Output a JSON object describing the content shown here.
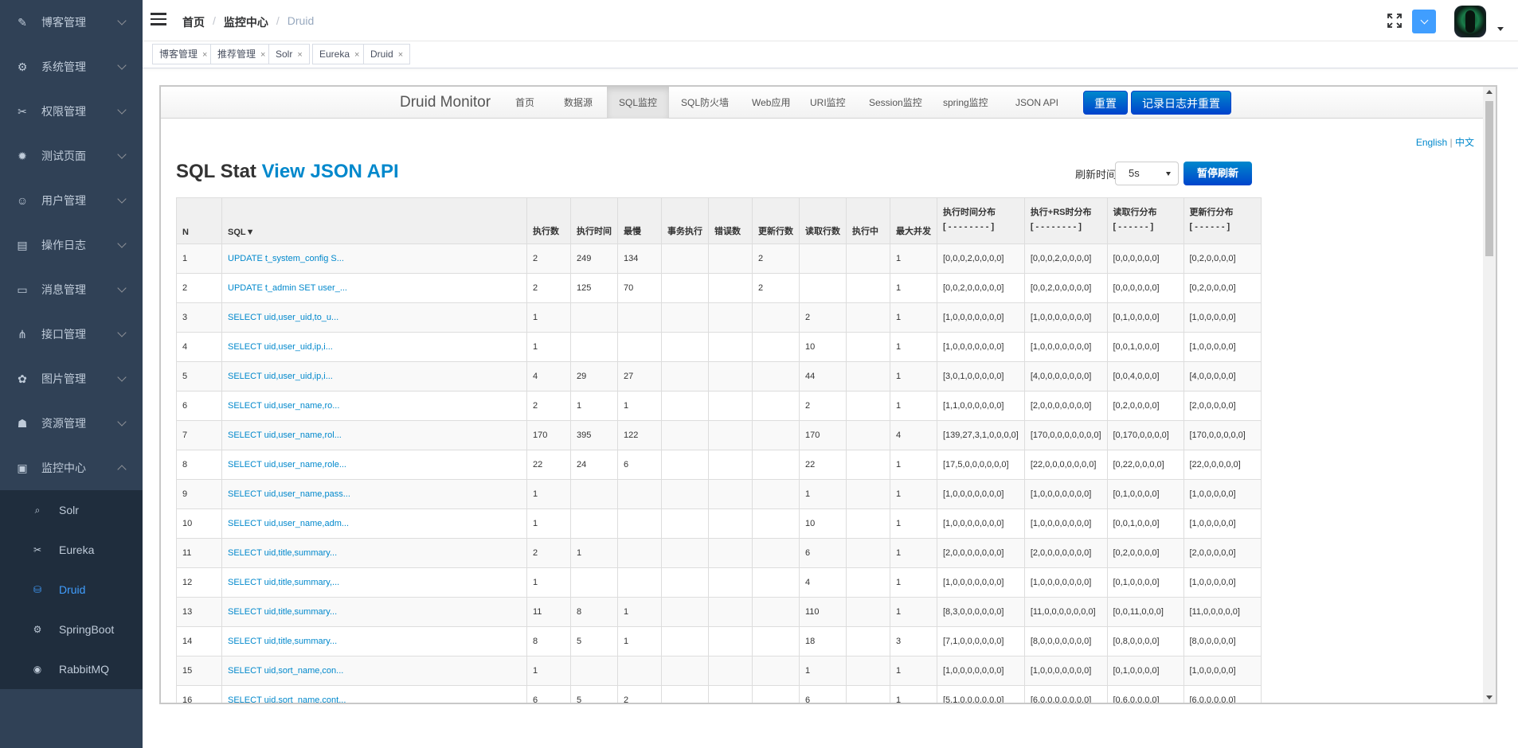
{
  "sidebar": {
    "items": [
      {
        "label": "博客管理",
        "icon": "edit-icon"
      },
      {
        "label": "系统管理",
        "icon": "gear-icon"
      },
      {
        "label": "权限管理",
        "icon": "tools-icon"
      },
      {
        "label": "测试页面",
        "icon": "bug-icon"
      },
      {
        "label": "用户管理",
        "icon": "user-icon"
      },
      {
        "label": "操作日志",
        "icon": "log-icon"
      },
      {
        "label": "消息管理",
        "icon": "message-icon"
      },
      {
        "label": "接口管理",
        "icon": "api-icon"
      },
      {
        "label": "图片管理",
        "icon": "picture-icon"
      },
      {
        "label": "资源管理",
        "icon": "education-icon"
      },
      {
        "label": "监控中心",
        "icon": "monitor-icon"
      }
    ],
    "submenu": [
      {
        "label": "Solr",
        "icon": "search-icon"
      },
      {
        "label": "Eureka",
        "icon": "tools-icon"
      },
      {
        "label": "Druid",
        "icon": "database-icon"
      },
      {
        "label": "SpringBoot",
        "icon": "gear-icon"
      },
      {
        "label": "RabbitMQ",
        "icon": "radar-icon"
      }
    ],
    "active_color": "#409eff",
    "bg_color": "#304156"
  },
  "breadcrumb": {
    "home": "首页",
    "parent": "监控中心",
    "current": "Druid"
  },
  "tags": [
    "博客管理",
    "推荐管理",
    "Solr",
    "Eureka",
    "Druid"
  ],
  "druid": {
    "brand": "Druid Monitor",
    "nav": [
      "首页",
      "数据源",
      "SQL监控",
      "SQL防火墙",
      "Web应用",
      "URI监控",
      "Session监控",
      "spring监控",
      "JSON API"
    ],
    "active_nav": "SQL监控",
    "reset": "重置",
    "log_reset": "记录日志并重置",
    "lang_en": "English",
    "lang_sep": "|",
    "lang_zh": "中文",
    "title": "SQL Stat",
    "title_link": "View JSON API",
    "refresh_label": "刷新时间",
    "refresh_value": "5s",
    "pause": "暂停刷新"
  },
  "table": {
    "headers": [
      "N",
      "SQL▼",
      "执行数",
      "执行时间",
      "最慢",
      "事务执行",
      "错误数",
      "更新行数",
      "读取行数",
      "执行中",
      "最大并发"
    ],
    "dist_headers": [
      {
        "label": "执行时间分布",
        "sub": "[ - - - - - - - - ]"
      },
      {
        "label": "执行+RS时分布",
        "sub": "[ - - - - - - - - ]"
      },
      {
        "label": "读取行分布",
        "sub": "[ - - - - - - ]"
      },
      {
        "label": "更新行分布",
        "sub": "[ - - - - - - ]"
      }
    ],
    "rows": [
      [
        "1",
        "UPDATE t_system_config S...",
        "2",
        "249",
        "134",
        "",
        "",
        "2",
        "",
        "",
        "1",
        "[0,0,0,2,0,0,0,0]",
        "[0,0,0,2,0,0,0,0]",
        "[0,0,0,0,0,0]",
        "[0,2,0,0,0,0]"
      ],
      [
        "2",
        "UPDATE t_admin SET user_...",
        "2",
        "125",
        "70",
        "",
        "",
        "2",
        "",
        "",
        "1",
        "[0,0,2,0,0,0,0,0]",
        "[0,0,2,0,0,0,0,0]",
        "[0,0,0,0,0,0]",
        "[0,2,0,0,0,0]"
      ],
      [
        "3",
        "SELECT uid,user_uid,to_u...",
        "1",
        "",
        "",
        "",
        "",
        "",
        "2",
        "",
        "1",
        "[1,0,0,0,0,0,0,0]",
        "[1,0,0,0,0,0,0,0]",
        "[0,1,0,0,0,0]",
        "[1,0,0,0,0,0]"
      ],
      [
        "4",
        "SELECT uid,user_uid,ip,i...",
        "1",
        "",
        "",
        "",
        "",
        "",
        "10",
        "",
        "1",
        "[1,0,0,0,0,0,0,0]",
        "[1,0,0,0,0,0,0,0]",
        "[0,0,1,0,0,0]",
        "[1,0,0,0,0,0]"
      ],
      [
        "5",
        "SELECT uid,user_uid,ip,i...",
        "4",
        "29",
        "27",
        "",
        "",
        "",
        "44",
        "",
        "1",
        "[3,0,1,0,0,0,0,0]",
        "[4,0,0,0,0,0,0,0]",
        "[0,0,4,0,0,0]",
        "[4,0,0,0,0,0]"
      ],
      [
        "6",
        "SELECT uid,user_name,ro...",
        "2",
        "1",
        "1",
        "",
        "",
        "",
        "2",
        "",
        "1",
        "[1,1,0,0,0,0,0,0]",
        "[2,0,0,0,0,0,0,0]",
        "[0,2,0,0,0,0]",
        "[2,0,0,0,0,0]"
      ],
      [
        "7",
        "SELECT uid,user_name,rol...",
        "170",
        "395",
        "122",
        "",
        "",
        "",
        "170",
        "",
        "4",
        "[139,27,3,1,0,0,0,0]",
        "[170,0,0,0,0,0,0,0]",
        "[0,170,0,0,0,0]",
        "[170,0,0,0,0,0]"
      ],
      [
        "8",
        "SELECT uid,user_name,role...",
        "22",
        "24",
        "6",
        "",
        "",
        "",
        "22",
        "",
        "1",
        "[17,5,0,0,0,0,0,0]",
        "[22,0,0,0,0,0,0,0]",
        "[0,22,0,0,0,0]",
        "[22,0,0,0,0,0]"
      ],
      [
        "9",
        "SELECT uid,user_name,pass...",
        "1",
        "",
        "",
        "",
        "",
        "",
        "1",
        "",
        "1",
        "[1,0,0,0,0,0,0,0]",
        "[1,0,0,0,0,0,0,0]",
        "[0,1,0,0,0,0]",
        "[1,0,0,0,0,0]"
      ],
      [
        "10",
        "SELECT uid,user_name,adm...",
        "1",
        "",
        "",
        "",
        "",
        "",
        "10",
        "",
        "1",
        "[1,0,0,0,0,0,0,0]",
        "[1,0,0,0,0,0,0,0]",
        "[0,0,1,0,0,0]",
        "[1,0,0,0,0,0]"
      ],
      [
        "11",
        "SELECT uid,title,summary...",
        "2",
        "1",
        "",
        "",
        "",
        "",
        "6",
        "",
        "1",
        "[2,0,0,0,0,0,0,0]",
        "[2,0,0,0,0,0,0,0]",
        "[0,2,0,0,0,0]",
        "[2,0,0,0,0,0]"
      ],
      [
        "12",
        "SELECT uid,title,summary,...",
        "1",
        "",
        "",
        "",
        "",
        "",
        "4",
        "",
        "1",
        "[1,0,0,0,0,0,0,0]",
        "[1,0,0,0,0,0,0,0]",
        "[0,1,0,0,0,0]",
        "[1,0,0,0,0,0]"
      ],
      [
        "13",
        "SELECT uid,title,summary...",
        "11",
        "8",
        "1",
        "",
        "",
        "",
        "110",
        "",
        "1",
        "[8,3,0,0,0,0,0,0]",
        "[11,0,0,0,0,0,0,0]",
        "[0,0,11,0,0,0]",
        "[11,0,0,0,0,0]"
      ],
      [
        "14",
        "SELECT uid,title,summary...",
        "8",
        "5",
        "1",
        "",
        "",
        "",
        "18",
        "",
        "3",
        "[7,1,0,0,0,0,0,0]",
        "[8,0,0,0,0,0,0,0]",
        "[0,8,0,0,0,0]",
        "[8,0,0,0,0,0]"
      ],
      [
        "15",
        "SELECT uid,sort_name,con...",
        "1",
        "",
        "",
        "",
        "",
        "",
        "1",
        "",
        "1",
        "[1,0,0,0,0,0,0,0]",
        "[1,0,0,0,0,0,0,0]",
        "[0,1,0,0,0,0]",
        "[1,0,0,0,0,0]"
      ],
      [
        "16",
        "SELECT uid,sort_name,cont...",
        "6",
        "5",
        "2",
        "",
        "",
        "",
        "6",
        "",
        "1",
        "[5,1,0,0,0,0,0,0]",
        "[6,0,0,0,0,0,0,0]",
        "[0,6,0,0,0,0]",
        "[6,0,0,0,0,0]"
      ]
    ]
  }
}
